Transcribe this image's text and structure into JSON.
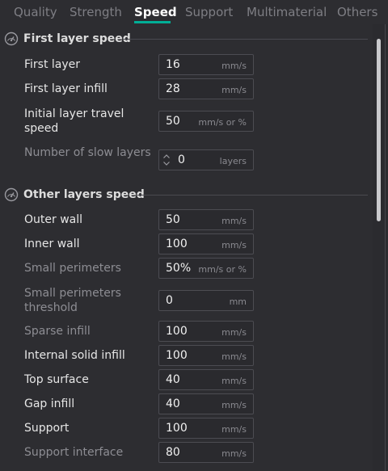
{
  "tabs": [
    {
      "label": "Quality"
    },
    {
      "label": "Strength"
    },
    {
      "label": "Speed"
    },
    {
      "label": "Support"
    },
    {
      "label": "Multimaterial"
    },
    {
      "label": "Others"
    }
  ],
  "active_tab": "Speed",
  "accent_color": "#00ae96",
  "sections": {
    "first_layer": {
      "title": "First layer speed",
      "icon": "speedometer-icon",
      "rows": [
        {
          "label": "First layer",
          "value": "16",
          "unit": "mm/s"
        },
        {
          "label": "First layer infill",
          "value": "28",
          "unit": "mm/s"
        },
        {
          "label": "Initial layer travel speed",
          "value": "50",
          "unit": "mm/s or %"
        },
        {
          "label": "Number of slow layers",
          "value": "0",
          "unit": "layers"
        }
      ]
    },
    "other_layers": {
      "title": "Other layers speed",
      "icon": "speedometer-icon",
      "rows": [
        {
          "label": "Outer wall",
          "value": "50",
          "unit": "mm/s"
        },
        {
          "label": "Inner wall",
          "value": "100",
          "unit": "mm/s"
        },
        {
          "label": "Small perimeters",
          "value": "50%",
          "unit": "mm/s or %"
        },
        {
          "label": "Small perimeters threshold",
          "value": "0",
          "unit": "mm"
        },
        {
          "label": "Sparse infill",
          "value": "100",
          "unit": "mm/s"
        },
        {
          "label": "Internal solid infill",
          "value": "100",
          "unit": "mm/s"
        },
        {
          "label": "Top surface",
          "value": "40",
          "unit": "mm/s"
        },
        {
          "label": "Gap infill",
          "value": "40",
          "unit": "mm/s"
        },
        {
          "label": "Support",
          "value": "100",
          "unit": "mm/s"
        },
        {
          "label": "Support interface",
          "value": "80",
          "unit": "mm/s"
        }
      ]
    }
  }
}
